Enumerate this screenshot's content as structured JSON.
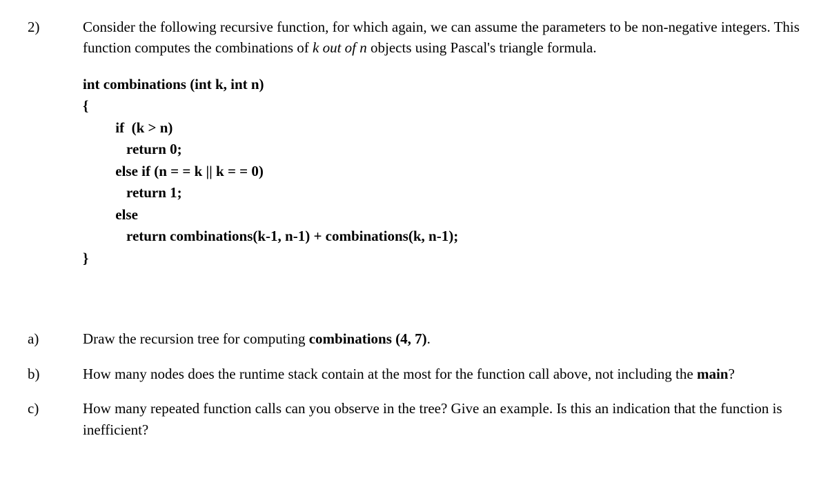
{
  "question": {
    "number": "2)",
    "intro": {
      "part1": "Consider the following recursive function, for which again, we can assume the parameters to be non-negative integers. This function computes the combinations of ",
      "italic1": "k out of n",
      "part2": " objects using Pascal's triangle formula."
    },
    "code": {
      "line1": "int combinations (int k, int n)",
      "line2": "{",
      "line3": "         if  (k > n)",
      "line4": "            return 0;",
      "line5": "         else if (n = = k || k = = 0)",
      "line6": "            return 1;",
      "line7": "         else",
      "line8": "            return combinations(k-1, n-1) + combinations(k, n-1);",
      "line9": "}"
    }
  },
  "subs": {
    "a": {
      "label": "a)",
      "text1": "Draw the recursion tree for computing ",
      "bold": "combinations (4, 7)",
      "text2": "."
    },
    "b": {
      "label": "b)",
      "text1": "How many nodes does the runtime stack contain at the most for the function call above, not including the ",
      "bold": "main",
      "text2": "?"
    },
    "c": {
      "label": "c)",
      "text": "How many repeated function calls can you observe in the tree? Give an example. Is this an indication that the function is inefficient?"
    }
  }
}
